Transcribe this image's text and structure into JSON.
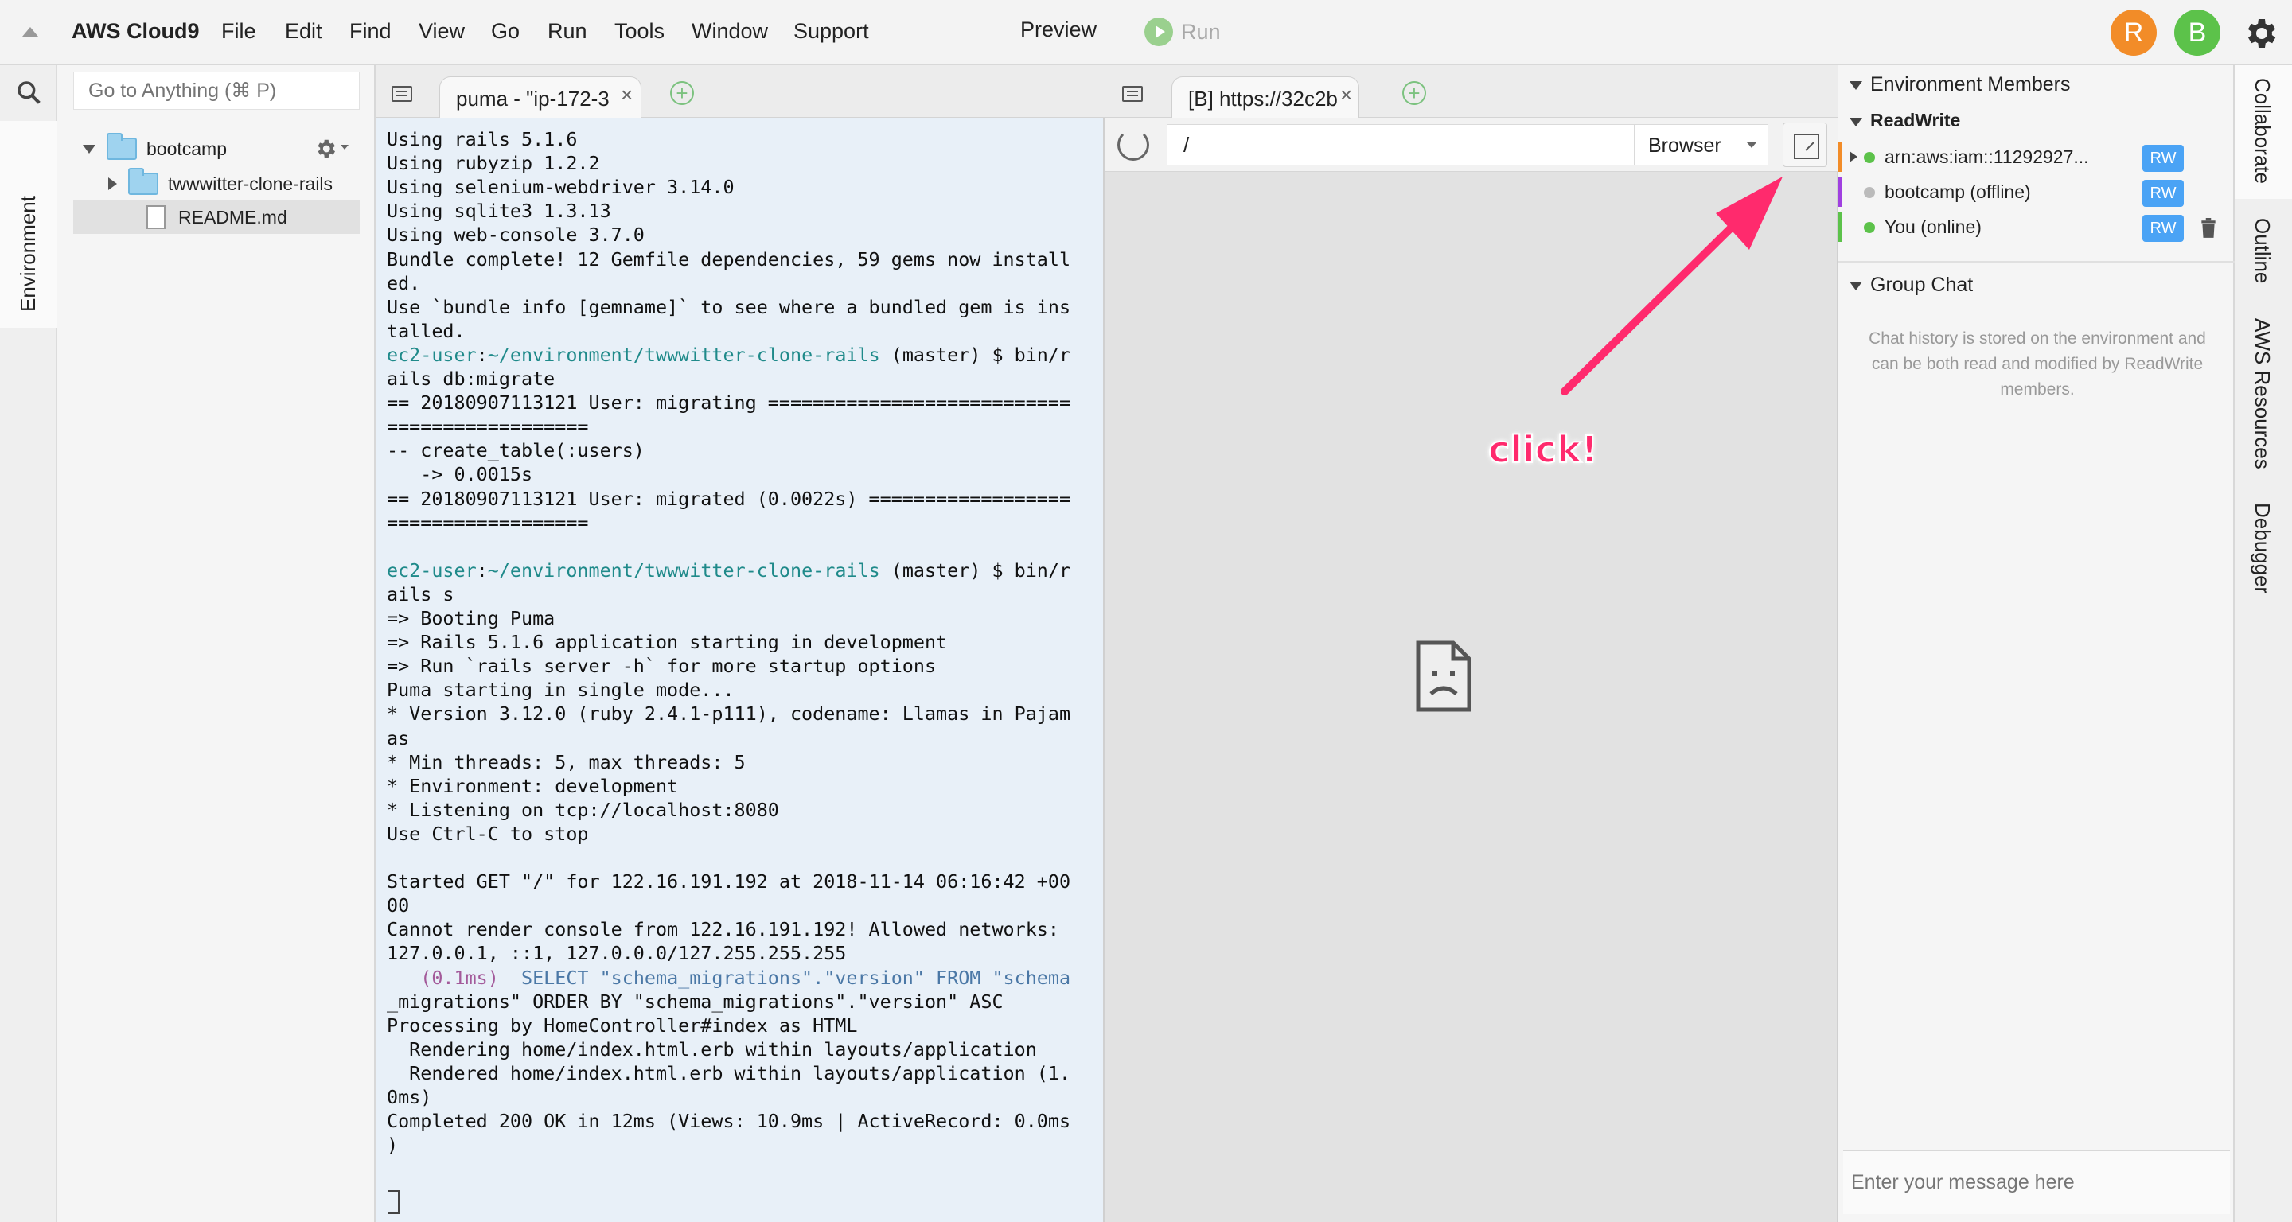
{
  "app": {
    "brand": "AWS Cloud9",
    "menu": [
      "File",
      "Edit",
      "Find",
      "View",
      "Go",
      "Run",
      "Tools",
      "Window",
      "Support"
    ],
    "preview_label": "Preview",
    "run_label": "Run",
    "avatars": [
      {
        "letter": "R",
        "color": "#f28c28"
      },
      {
        "letter": "B",
        "color": "#5cc24a"
      }
    ]
  },
  "left_rail": {
    "environment_label": "Environment"
  },
  "file_panel": {
    "goto_placeholder": "Go to Anything (⌘ P)",
    "tree": [
      {
        "name": "bootcamp",
        "type": "folder",
        "expanded": true
      },
      {
        "name": "twwwitter-clone-rails",
        "type": "folder",
        "expanded": false
      },
      {
        "name": "README.md",
        "type": "file",
        "selected": true
      }
    ]
  },
  "terminal_tab": {
    "title": "puma - \"ip-172-3"
  },
  "preview_tab": {
    "title": "[B] https://32c2b"
  },
  "terminal": {
    "lines": [
      {
        "t": "Using rails 5.1.6",
        "c": ""
      },
      {
        "t": "Using rubyzip 1.2.2",
        "c": ""
      },
      {
        "t": "Using selenium-webdriver 3.14.0",
        "c": ""
      },
      {
        "t": "Using sqlite3 1.3.13",
        "c": ""
      },
      {
        "t": "Using web-console 3.7.0",
        "c": ""
      },
      {
        "t": "Bundle complete! 12 Gemfile dependencies, 59 gems now install",
        "c": "c-green"
      },
      {
        "t": "ed.",
        "c": "c-green"
      },
      {
        "t": "Use `bundle info [gemname]` to see where a bundled gem is ins",
        "c": "c-green"
      },
      {
        "t": "talled.",
        "c": "c-green"
      },
      {
        "t": "ec2-user:~/environment/twwwitter-clone-rails (master) $ bin/r",
        "c": "prompt"
      },
      {
        "t": "ails db:migrate",
        "c": ""
      },
      {
        "t": "== 20180907113121 User: migrating ===========================",
        "c": ""
      },
      {
        "t": "==================",
        "c": ""
      },
      {
        "t": "-- create_table(:users)",
        "c": ""
      },
      {
        "t": "   -> 0.0015s",
        "c": ""
      },
      {
        "t": "== 20180907113121 User: migrated (0.0022s) ==================",
        "c": ""
      },
      {
        "t": "==================",
        "c": ""
      },
      {
        "t": "",
        "c": ""
      },
      {
        "t": "ec2-user:~/environment/twwwitter-clone-rails (master) $ bin/r",
        "c": "prompt"
      },
      {
        "t": "ails s",
        "c": ""
      },
      {
        "t": "=> Booting Puma",
        "c": ""
      },
      {
        "t": "=> Rails 5.1.6 application starting in development",
        "c": ""
      },
      {
        "t": "=> Run `rails server -h` for more startup options",
        "c": ""
      },
      {
        "t": "Puma starting in single mode...",
        "c": ""
      },
      {
        "t": "* Version 3.12.0 (ruby 2.4.1-p111), codename: Llamas in Pajam",
        "c": ""
      },
      {
        "t": "as",
        "c": ""
      },
      {
        "t": "* Min threads: 5, max threads: 5",
        "c": ""
      },
      {
        "t": "* Environment: development",
        "c": ""
      },
      {
        "t": "* Listening on tcp://localhost:8080",
        "c": ""
      },
      {
        "t": "Use Ctrl-C to stop",
        "c": ""
      },
      {
        "t": "",
        "c": ""
      },
      {
        "t": "Started GET \"/\" for 122.16.191.192 at 2018-11-14 06:16:42 +00",
        "c": ""
      },
      {
        "t": "00",
        "c": ""
      },
      {
        "t": "Cannot render console from 122.16.191.192! Allowed networks:",
        "c": ""
      },
      {
        "t": "127.0.0.1, ::1, 127.0.0.0/127.255.255.255",
        "c": ""
      },
      {
        "t": "   (0.1ms)  SELECT \"schema_migrations\".\"version\" FROM \"schema",
        "c": "sql"
      },
      {
        "t": "_migrations\" ORDER BY \"schema_migrations\".\"version\" ASC",
        "c": "c-blue"
      },
      {
        "t": "Processing by HomeController#index as HTML",
        "c": ""
      },
      {
        "t": "  Rendering home/index.html.erb within layouts/application",
        "c": ""
      },
      {
        "t": "  Rendered home/index.html.erb within layouts/application (1.",
        "c": ""
      },
      {
        "t": "0ms)",
        "c": ""
      },
      {
        "t": "Completed 200 OK in 12ms (Views: 10.9ms | ActiveRecord: 0.0ms",
        "c": ""
      },
      {
        "t": ")",
        "c": ""
      }
    ]
  },
  "preview": {
    "url_value": "/",
    "browser_label": "Browser",
    "annotation": "click!",
    "annotation_color": "#ff2a6d"
  },
  "collab": {
    "members_title": "Environment Members",
    "group_label": "ReadWrite",
    "members": [
      {
        "name": "arn:aws:iam::11292927...",
        "status_color": "#5cc24a",
        "bar_color": "#f28c28",
        "badge": "RW",
        "expandable": true
      },
      {
        "name": "bootcamp (offline)",
        "status_color": "#bbbbbb",
        "bar_color": "#a040e0",
        "badge": "RW",
        "expandable": false
      },
      {
        "name": "You (online)",
        "status_color": "#5cc24a",
        "bar_color": "#5cc24a",
        "badge": "RW",
        "expandable": false
      }
    ],
    "chat_title": "Group Chat",
    "chat_info": "Chat history is stored on the environment and can be both read and modified by ReadWrite members.",
    "chat_placeholder": "Enter your message here"
  },
  "right_rail": {
    "tabs": [
      "Collaborate",
      "Outline",
      "AWS Resources",
      "Debugger"
    ]
  }
}
